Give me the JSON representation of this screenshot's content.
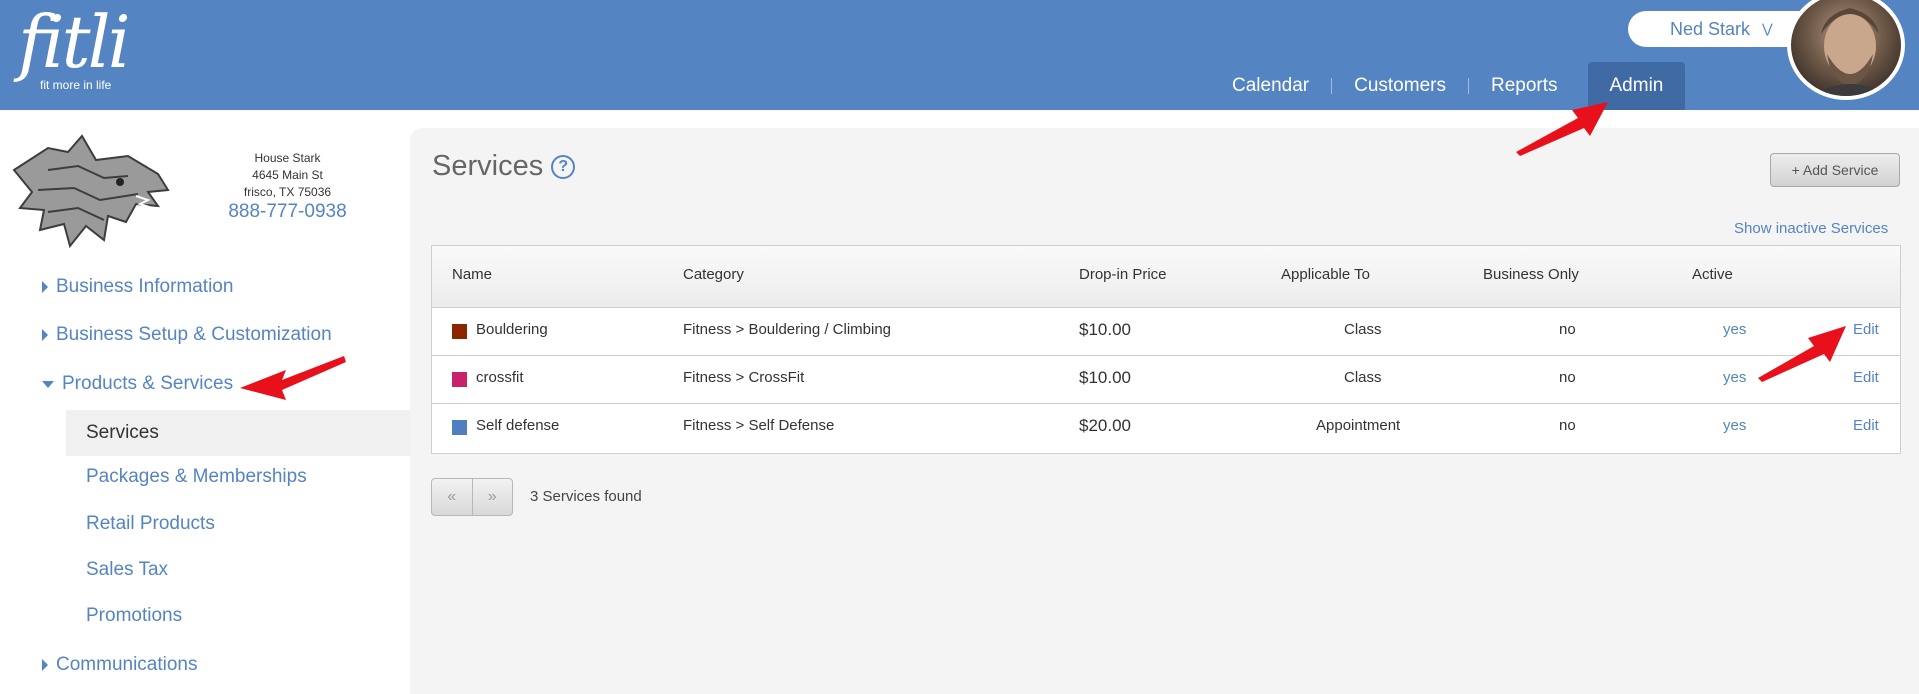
{
  "brand": {
    "logo_text": "fitli",
    "tagline": "fit more in life"
  },
  "user": {
    "name": "Ned Stark"
  },
  "nav": [
    {
      "label": "Calendar",
      "active": false
    },
    {
      "label": "Customers",
      "active": false
    },
    {
      "label": "Reports",
      "active": false
    },
    {
      "label": "Admin",
      "active": true
    }
  ],
  "business": {
    "name": "House Stark",
    "street": "4645 Main St",
    "city": "frisco, TX 75036",
    "phone": "888-777-0938"
  },
  "sidebar": {
    "items": [
      {
        "label": "Business Information",
        "expanded": false
      },
      {
        "label": "Business Setup & Customization",
        "expanded": false
      },
      {
        "label": "Products & Services",
        "expanded": true
      },
      {
        "label": "Communications",
        "expanded": false
      }
    ],
    "subitems": [
      {
        "label": "Services",
        "active": true
      },
      {
        "label": "Packages & Memberships",
        "active": false
      },
      {
        "label": "Retail Products",
        "active": false
      },
      {
        "label": "Sales Tax",
        "active": false
      },
      {
        "label": "Promotions",
        "active": false
      }
    ]
  },
  "main": {
    "title": "Services",
    "help_icon": "question-circle-icon",
    "add_button": "+ Add Service",
    "inactive_link": "Show inactive Services",
    "columns": [
      "Name",
      "Category",
      "Drop-in Price",
      "Applicable To",
      "Business Only",
      "Active"
    ],
    "rows": [
      {
        "color": "#8b2500",
        "name": "Bouldering",
        "category": "Fitness > Bouldering / Climbing",
        "price": "$10.00",
        "applicable": "Class",
        "business_only": "no",
        "active": "yes",
        "edit": "Edit"
      },
      {
        "color": "#c8226a",
        "name": "crossfit",
        "category": "Fitness > CrossFit",
        "price": "$10.00",
        "applicable": "Class",
        "business_only": "no",
        "active": "yes",
        "edit": "Edit"
      },
      {
        "color": "#4f7fc0",
        "name": "Self defense",
        "category": "Fitness > Self Defense",
        "price": "$20.00",
        "applicable": "Appointment",
        "business_only": "no",
        "active": "yes",
        "edit": "Edit"
      }
    ],
    "pager": {
      "prev": "«",
      "next": "»"
    },
    "found_text": "3 Services found"
  },
  "colors": {
    "header": "#5584c2",
    "nav_active": "#3f6aa3",
    "link": "#5584c2",
    "annotation_arrow": "#e8101a"
  }
}
